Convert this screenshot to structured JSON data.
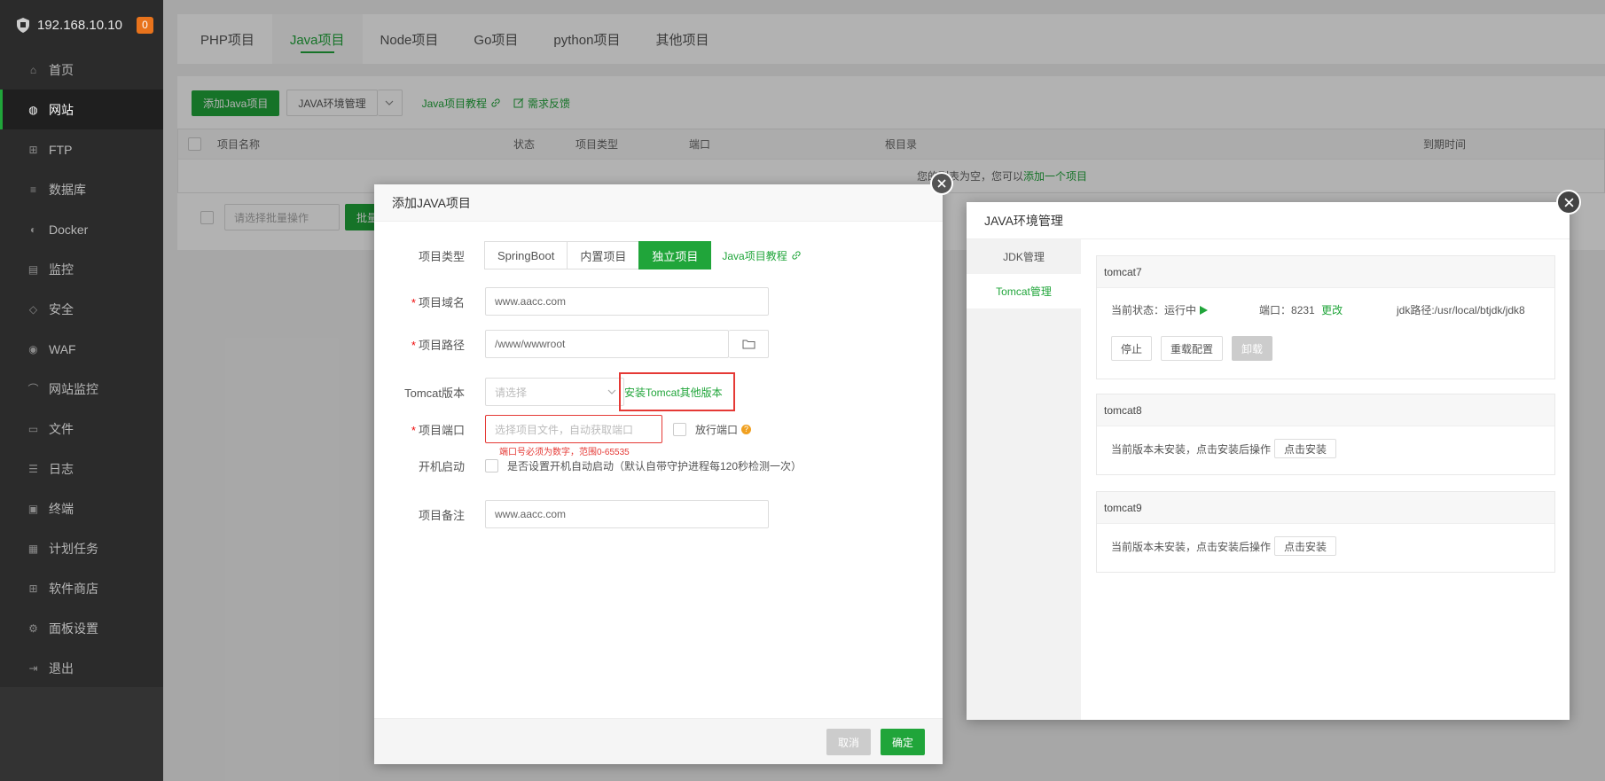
{
  "sidebar": {
    "host": "192.168.10.10",
    "badge": "0",
    "items": [
      {
        "label": "首页",
        "icon": "home-icon"
      },
      {
        "label": "网站",
        "icon": "globe-icon",
        "active": true
      },
      {
        "label": "FTP",
        "icon": "ftp-icon"
      },
      {
        "label": "数据库",
        "icon": "database-icon"
      },
      {
        "label": "Docker",
        "icon": "docker-icon"
      },
      {
        "label": "监控",
        "icon": "monitor-icon"
      },
      {
        "label": "安全",
        "icon": "shield-icon"
      },
      {
        "label": "WAF",
        "icon": "waf-icon"
      },
      {
        "label": "网站监控",
        "icon": "chart-icon"
      },
      {
        "label": "文件",
        "icon": "folder-icon"
      },
      {
        "label": "日志",
        "icon": "log-icon"
      },
      {
        "label": "终端",
        "icon": "terminal-icon"
      },
      {
        "label": "计划任务",
        "icon": "calendar-icon"
      },
      {
        "label": "软件商店",
        "icon": "grid-icon"
      },
      {
        "label": "面板设置",
        "icon": "settings-icon"
      },
      {
        "label": "退出",
        "icon": "logout-icon"
      }
    ]
  },
  "tabs": [
    "PHP项目",
    "Java项目",
    "Node项目",
    "Go项目",
    "python项目",
    "其他项目"
  ],
  "toolbar": {
    "add_button": "添加Java项目",
    "env_button": "JAVA环境管理",
    "tutorial_link": "Java项目教程",
    "feedback_link": "需求反馈"
  },
  "table": {
    "headers": {
      "name": "项目名称",
      "status": "状态",
      "type": "项目类型",
      "port": "端口",
      "root": "根目录",
      "expire": "到期时间"
    },
    "empty_text": "您的列表为空，您可以",
    "empty_link": "添加一个项目",
    "batch_placeholder": "请选择批量操作",
    "batch_button": "批量"
  },
  "add_dialog": {
    "title": "添加JAVA项目",
    "type_label": "项目类型",
    "type_options": [
      "SpringBoot",
      "内置项目",
      "独立项目"
    ],
    "type_selected": "独立项目",
    "tutorial_link": "Java项目教程",
    "domain_label": "项目域名",
    "domain_value": "www.aacc.com",
    "path_label": "项目路径",
    "path_value": "/www/wwwroot",
    "tomcat_label": "Tomcat版本",
    "tomcat_placeholder": "请选择",
    "install_tomcat_link": "安装Tomcat其他版本",
    "port_label": "项目端口",
    "port_placeholder": "选择项目文件，自动获取端口",
    "port_error": "端口号必须为数字，范围0-65535",
    "release_port_label": "放行端口",
    "autostart_label": "开机启动",
    "autostart_text": "是否设置开机自动启动（默认自带守护进程每120秒检测一次）",
    "remark_label": "项目备注",
    "remark_value": "www.aacc.com",
    "cancel": "取消",
    "confirm": "确定"
  },
  "env_dialog": {
    "title": "JAVA环境管理",
    "side_tabs": [
      "JDK管理",
      "Tomcat管理"
    ],
    "side_active": "Tomcat管理",
    "tomcat7": {
      "name": "tomcat7",
      "status_label": "当前状态：",
      "status_value": "运行中",
      "port_label": "端口：",
      "port_value": "8231",
      "port_change": "更改",
      "jdk_path": "jdk路径:/usr/local/btjdk/jdk8",
      "stop": "停止",
      "reload": "重载配置",
      "uninstall": "卸载"
    },
    "tomcat8": {
      "name": "tomcat8",
      "text": "当前版本未安装，点击安装后操作",
      "install": "点击安装"
    },
    "tomcat9": {
      "name": "tomcat9",
      "text": "当前版本未安装，点击安装后操作",
      "install": "点击安装"
    }
  },
  "colors": {
    "accent": "#20a53a",
    "sidebar_bg": "#2b2b2b",
    "highlight_box": "#e53935",
    "badge": "#e8731c"
  }
}
